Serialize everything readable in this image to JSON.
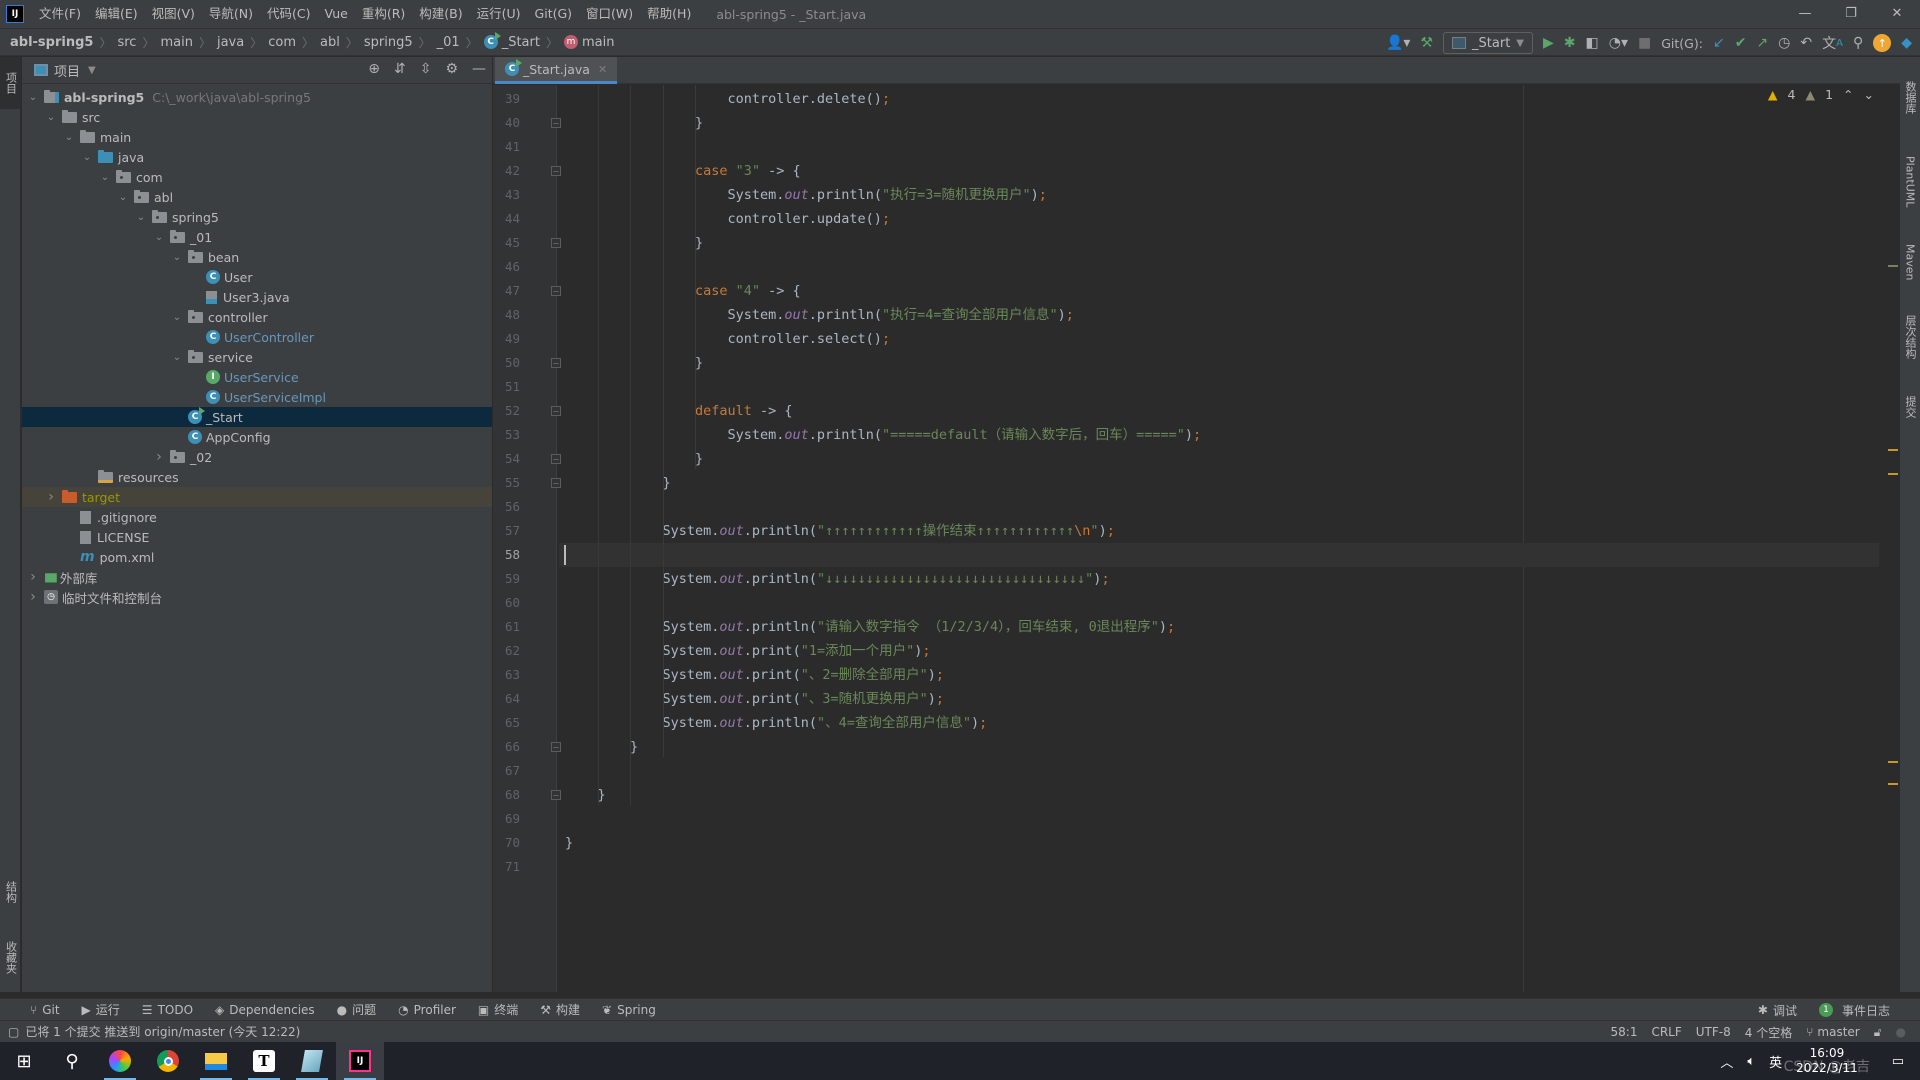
{
  "app": {
    "window_title": "abl-spring5 - _Start.java",
    "menu": [
      "文件(F)",
      "编辑(E)",
      "视图(V)",
      "导航(N)",
      "代码(C)",
      "Vue",
      "重构(R)",
      "构建(B)",
      "运行(U)",
      "Git(G)",
      "窗口(W)",
      "帮助(H)"
    ],
    "logo": "IJ"
  },
  "breadcrumb": [
    "abl-spring5",
    "src",
    "main",
    "java",
    "com",
    "abl",
    "spring5",
    "_01",
    "_Start",
    "main"
  ],
  "toolbar": {
    "run_config": "_Start",
    "git_label": "Git(G):",
    "icons": [
      "user-icon",
      "build-hammer-icon",
      "run-icon",
      "debug-icon",
      "coverage-icon",
      "profile-icon",
      "stop-icon",
      "git-update-icon",
      "git-commit-icon",
      "git-push-icon",
      "history-icon",
      "rollback-icon",
      "translate-icon",
      "search-icon",
      "update-icon",
      "toolbox-icon"
    ]
  },
  "left_strip": {
    "tabs": [
      "项目",
      "结构",
      "收藏夹"
    ]
  },
  "project_panel": {
    "title": "项目",
    "tree": [
      {
        "depth": 0,
        "arrow": "down",
        "icon": "module",
        "label": "abl-spring5",
        "hint": "C:\\_work\\java\\abl-spring5",
        "bold": true
      },
      {
        "depth": 1,
        "arrow": "down",
        "icon": "folder",
        "label": "src"
      },
      {
        "depth": 2,
        "arrow": "down",
        "icon": "folder",
        "label": "main"
      },
      {
        "depth": 3,
        "arrow": "down",
        "icon": "src-folder",
        "label": "java"
      },
      {
        "depth": 4,
        "arrow": "down",
        "icon": "package",
        "label": "com"
      },
      {
        "depth": 5,
        "arrow": "down",
        "icon": "package",
        "label": "abl"
      },
      {
        "depth": 6,
        "arrow": "down",
        "icon": "package",
        "label": "spring5"
      },
      {
        "depth": 7,
        "arrow": "down",
        "icon": "package",
        "label": "_01"
      },
      {
        "depth": 8,
        "arrow": "down",
        "icon": "package",
        "label": "bean"
      },
      {
        "depth": 9,
        "arrow": "",
        "icon": "class",
        "label": "User"
      },
      {
        "depth": 9,
        "arrow": "",
        "icon": "java-file",
        "label": "User3.java"
      },
      {
        "depth": 8,
        "arrow": "down",
        "icon": "package",
        "label": "controller"
      },
      {
        "depth": 9,
        "arrow": "",
        "icon": "class",
        "label": "UserController",
        "color": "blue"
      },
      {
        "depth": 8,
        "arrow": "down",
        "icon": "package",
        "label": "service"
      },
      {
        "depth": 9,
        "arrow": "",
        "icon": "interface",
        "label": "UserService",
        "color": "blue"
      },
      {
        "depth": 9,
        "arrow": "",
        "icon": "class",
        "label": "UserServiceImpl",
        "color": "blue"
      },
      {
        "depth": 8,
        "arrow": "",
        "icon": "run-class",
        "label": "_Start",
        "selected": true
      },
      {
        "depth": 8,
        "arrow": "",
        "icon": "class",
        "label": "AppConfig"
      },
      {
        "depth": 7,
        "arrow": "right",
        "icon": "package",
        "label": "_02"
      },
      {
        "depth": 3,
        "arrow": "",
        "icon": "resources-folder",
        "label": "resources"
      },
      {
        "depth": 1,
        "arrow": "right",
        "icon": "target-folder",
        "label": "target",
        "color": "olive",
        "excluded": true
      },
      {
        "depth": 2,
        "arrow": "",
        "icon": "ignore-file",
        "label": ".gitignore"
      },
      {
        "depth": 2,
        "arrow": "",
        "icon": "text-file",
        "label": "LICENSE"
      },
      {
        "depth": 2,
        "arrow": "",
        "icon": "maven-file",
        "label": "pom.xml"
      },
      {
        "depth": 0,
        "arrow": "right",
        "icon": "library",
        "label": "外部库"
      },
      {
        "depth": 0,
        "arrow": "right",
        "icon": "scratch",
        "label": "临时文件和控制台"
      }
    ]
  },
  "editor": {
    "tab_label": "_Start.java",
    "inspections": {
      "warnings": "4",
      "weak_warnings": "1"
    },
    "current_line": 58,
    "lines": [
      {
        "n": 39,
        "indent": 5,
        "parts": [
          [
            "t",
            "controller.delete()"
          ],
          [
            "semi",
            ";"
          ]
        ]
      },
      {
        "n": 40,
        "indent": 4,
        "parts": [
          [
            "t",
            "}"
          ]
        ],
        "fold": "end"
      },
      {
        "n": 41,
        "indent": 0,
        "parts": []
      },
      {
        "n": 42,
        "indent": 4,
        "parts": [
          [
            "kw",
            "case "
          ],
          [
            "str",
            "\"3\""
          ],
          [
            "t",
            " -> {"
          ]
        ],
        "fold": "start"
      },
      {
        "n": 43,
        "indent": 5,
        "parts": [
          [
            "t",
            "System."
          ],
          [
            "fld",
            "out"
          ],
          [
            "t",
            ".println("
          ],
          [
            "str",
            "\"执行=3=随机更换用户\""
          ],
          [
            "t",
            ")"
          ],
          [
            "semi",
            ";"
          ]
        ]
      },
      {
        "n": 44,
        "indent": 5,
        "parts": [
          [
            "t",
            "controller.update()"
          ],
          [
            "semi",
            ";"
          ]
        ]
      },
      {
        "n": 45,
        "indent": 4,
        "parts": [
          [
            "t",
            "}"
          ]
        ],
        "fold": "end"
      },
      {
        "n": 46,
        "indent": 0,
        "parts": []
      },
      {
        "n": 47,
        "indent": 4,
        "parts": [
          [
            "kw",
            "case "
          ],
          [
            "str",
            "\"4\""
          ],
          [
            "t",
            " -> {"
          ]
        ],
        "fold": "start"
      },
      {
        "n": 48,
        "indent": 5,
        "parts": [
          [
            "t",
            "System."
          ],
          [
            "fld",
            "out"
          ],
          [
            "t",
            ".println("
          ],
          [
            "str",
            "\"执行=4=查询全部用户信息\""
          ],
          [
            "t",
            ")"
          ],
          [
            "semi",
            ";"
          ]
        ]
      },
      {
        "n": 49,
        "indent": 5,
        "parts": [
          [
            "t",
            "controller.select()"
          ],
          [
            "semi",
            ";"
          ]
        ]
      },
      {
        "n": 50,
        "indent": 4,
        "parts": [
          [
            "t",
            "}"
          ]
        ],
        "fold": "end"
      },
      {
        "n": 51,
        "indent": 0,
        "parts": []
      },
      {
        "n": 52,
        "indent": 4,
        "parts": [
          [
            "kw",
            "default"
          ],
          [
            "t",
            " -> {"
          ]
        ],
        "fold": "start"
      },
      {
        "n": 53,
        "indent": 5,
        "parts": [
          [
            "t",
            "System."
          ],
          [
            "fld",
            "out"
          ],
          [
            "t",
            ".println("
          ],
          [
            "str",
            "\"=====default（请输入数字后，回车）=====\""
          ],
          [
            "t",
            ")"
          ],
          [
            "semi",
            ";"
          ]
        ]
      },
      {
        "n": 54,
        "indent": 4,
        "parts": [
          [
            "t",
            "}"
          ]
        ],
        "fold": "end"
      },
      {
        "n": 55,
        "indent": 3,
        "parts": [
          [
            "t",
            "}"
          ]
        ],
        "fold": "end"
      },
      {
        "n": 56,
        "indent": 0,
        "parts": []
      },
      {
        "n": 57,
        "indent": 3,
        "parts": [
          [
            "t",
            "System."
          ],
          [
            "fld",
            "out"
          ],
          [
            "t",
            ".println("
          ],
          [
            "str",
            "\"↑↑↑↑↑↑↑↑↑↑↑↑操作结束↑↑↑↑↑↑↑↑↑↑↑↑"
          ],
          [
            "esc",
            "\\n"
          ],
          [
            "str",
            "\""
          ],
          [
            "t",
            ")"
          ],
          [
            "semi",
            ";"
          ]
        ]
      },
      {
        "n": 58,
        "indent": 0,
        "parts": []
      },
      {
        "n": 59,
        "indent": 3,
        "parts": [
          [
            "t",
            "System."
          ],
          [
            "fld",
            "out"
          ],
          [
            "t",
            ".println("
          ],
          [
            "str",
            "\"↓↓↓↓↓↓↓↓↓↓↓↓↓↓↓↓↓↓↓↓↓↓↓↓↓↓↓↓↓↓↓↓\""
          ],
          [
            "t",
            ")"
          ],
          [
            "semi",
            ";"
          ]
        ]
      },
      {
        "n": 60,
        "indent": 0,
        "parts": []
      },
      {
        "n": 61,
        "indent": 3,
        "parts": [
          [
            "t",
            "System."
          ],
          [
            "fld",
            "out"
          ],
          [
            "t",
            ".println("
          ],
          [
            "str",
            "\"请输入数字指令 （1/2/3/4），回车结束, 0退出程序\""
          ],
          [
            "t",
            ")"
          ],
          [
            "semi",
            ";"
          ]
        ]
      },
      {
        "n": 62,
        "indent": 3,
        "parts": [
          [
            "t",
            "System."
          ],
          [
            "fld",
            "out"
          ],
          [
            "t",
            ".print("
          ],
          [
            "str",
            "\"1=添加一个用户\""
          ],
          [
            "t",
            ")"
          ],
          [
            "semi",
            ";"
          ]
        ]
      },
      {
        "n": 63,
        "indent": 3,
        "parts": [
          [
            "t",
            "System."
          ],
          [
            "fld",
            "out"
          ],
          [
            "t",
            ".print("
          ],
          [
            "str",
            "\"、2=删除全部用户\""
          ],
          [
            "t",
            ")"
          ],
          [
            "semi",
            ";"
          ]
        ]
      },
      {
        "n": 64,
        "indent": 3,
        "parts": [
          [
            "t",
            "System."
          ],
          [
            "fld",
            "out"
          ],
          [
            "t",
            ".print("
          ],
          [
            "str",
            "\"、3=随机更换用户\""
          ],
          [
            "t",
            ")"
          ],
          [
            "semi",
            ";"
          ]
        ]
      },
      {
        "n": 65,
        "indent": 3,
        "parts": [
          [
            "t",
            "System."
          ],
          [
            "fld",
            "out"
          ],
          [
            "t",
            ".println("
          ],
          [
            "str",
            "\"、4=查询全部用户信息\""
          ],
          [
            "t",
            ")"
          ],
          [
            "semi",
            ";"
          ]
        ]
      },
      {
        "n": 66,
        "indent": 2,
        "parts": [
          [
            "t",
            "}"
          ]
        ],
        "fold": "end"
      },
      {
        "n": 67,
        "indent": 0,
        "parts": []
      },
      {
        "n": 68,
        "indent": 1,
        "parts": [
          [
            "t",
            "}"
          ]
        ],
        "fold": "end"
      },
      {
        "n": 69,
        "indent": 0,
        "parts": []
      },
      {
        "n": 70,
        "indent": 0,
        "parts": [
          [
            "t",
            "}"
          ]
        ]
      },
      {
        "n": 71,
        "indent": 0,
        "parts": []
      }
    ]
  },
  "right_strip": {
    "tabs": [
      "数据库",
      "PlantUML",
      "Maven",
      "层次结构",
      "提交"
    ]
  },
  "toolwindows": {
    "left": [
      {
        "icon": "git-icon",
        "label": "Git"
      },
      {
        "icon": "run-icon",
        "label": "运行"
      },
      {
        "icon": "todo-icon",
        "label": "TODO"
      },
      {
        "icon": "dependencies-icon",
        "label": "Dependencies"
      },
      {
        "icon": "problems-icon",
        "label": "问题"
      },
      {
        "icon": "profiler-icon",
        "label": "Profiler"
      },
      {
        "icon": "terminal-icon",
        "label": "终端"
      },
      {
        "icon": "build-icon",
        "label": "构建"
      },
      {
        "icon": "spring-icon",
        "label": "Spring"
      }
    ],
    "right": [
      {
        "icon": "debug-icon",
        "label": "调试"
      },
      {
        "icon": "event-log-icon",
        "label": "事件日志",
        "badge": "1"
      }
    ]
  },
  "statusbar": {
    "message": "已将 1 个提交 推送到 origin/master (今天 12:22)",
    "position": "58:1",
    "line_sep": "CRLF",
    "encoding": "UTF-8",
    "indent": "4 个空格",
    "branch": "master"
  },
  "taskbar": {
    "apps": [
      "start-icon",
      "search-icon",
      "app-colorful-icon",
      "chrome-icon",
      "file-explorer-icon",
      "typora-icon",
      "notepad-icon",
      "intellij-icon"
    ],
    "tray_lang": "英",
    "time": "16:09",
    "date": "2022/3/11",
    "watermark": "CSDN @老吉"
  }
}
